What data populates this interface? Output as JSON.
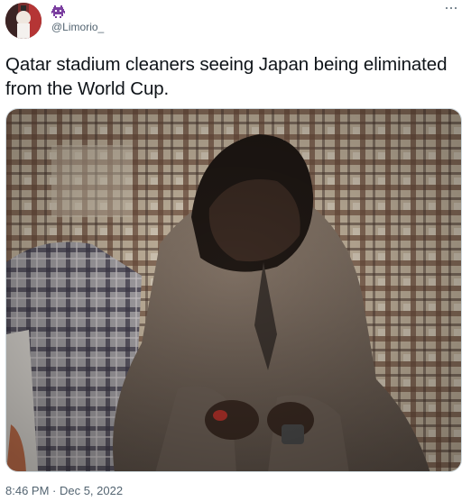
{
  "author": {
    "handle": "@Limorio_",
    "display_name_icon": "alien-monster-icon",
    "avatar_icon": "avatar-photo"
  },
  "more_icon": "more-horizontal-icon",
  "tweet": {
    "text": "Qatar stadium cleaners seeing Japan being eliminated from the World Cup.",
    "timestamp": "8:46 PM · Dec 5, 2022"
  },
  "media": {
    "kind": "photo",
    "icon": "photo-image"
  },
  "colors": {
    "text_primary": "#0f1419",
    "text_secondary": "#536471",
    "border": "#cfd9de",
    "name_emoji": "#7b3fa0"
  }
}
